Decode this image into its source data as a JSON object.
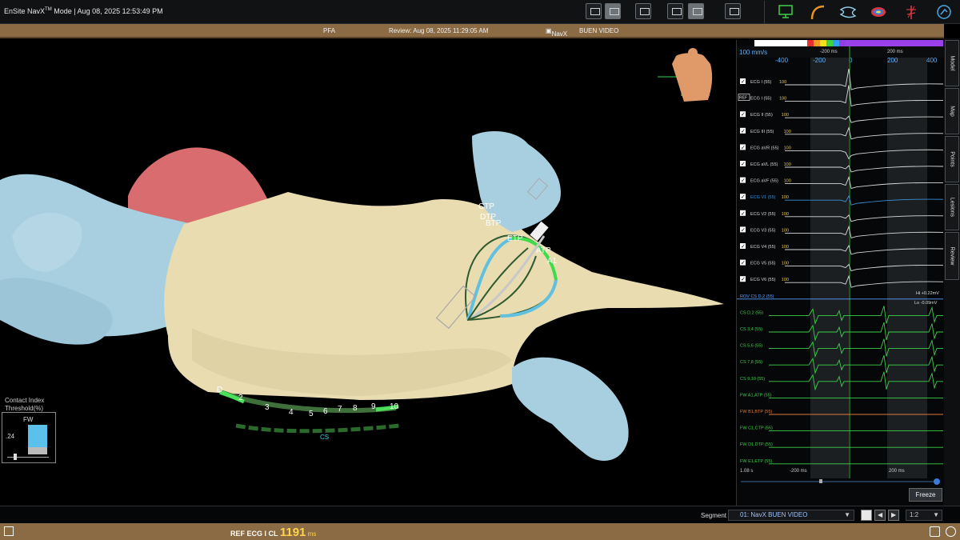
{
  "app": {
    "title_main": "EnSite NavX",
    "title_tm": "TM",
    "title_rest": " Mode |   Aug 08, 2025 12:53:49 PM"
  },
  "toolbar": {
    "icons": [
      "camera-icon",
      "screen-capture-icon",
      "record-icon",
      "split-view-icon",
      "layout-icon",
      "settings-icon"
    ],
    "right_icons": [
      "monitor-icon",
      "catheter-icon",
      "map-icon",
      "model-icon",
      "ablation-icon",
      "help-icon"
    ]
  },
  "review": {
    "mode": "PFA",
    "timestamp": "Review: Aug 08, 2025 11:29:05 AM",
    "system": "NavX",
    "study": "BUEN VIDEO"
  },
  "viewport": {
    "catheter_labels": [
      "CTP",
      "DTP",
      "BTP",
      "ETP",
      "ATP",
      "A1"
    ],
    "cs_electrode_labels": [
      "D",
      "2",
      "3",
      "4",
      "5",
      "6",
      "7",
      "8",
      "9",
      "10"
    ],
    "cs_label": "CS",
    "contact": {
      "title_line1": "Contact Index",
      "title_line2": "Threshold(%)",
      "catheter": "FW",
      "value": ".24",
      "fill_fraction": 0.75,
      "color": "#5bc0ea"
    },
    "colors": {
      "chamber": "#e8dcb0",
      "veins": "#a8cfe0",
      "appendage": "#d96c6f"
    }
  },
  "ecg": {
    "sweep_speed": "100 mm/s",
    "scale_top": [
      "-400",
      "-200",
      "0",
      "200",
      "400"
    ],
    "window_left": "-200 ms",
    "window_right": "200 ms",
    "bottom_time": "1.08 s",
    "bottom_left": "-200 ms",
    "bottom_right": "200 ms",
    "hi_label": "Hi +0.22mV",
    "lo_label": "Lo -0.09mV",
    "channels": [
      {
        "label": "ECG I (55)",
        "gain": "100",
        "color": "#d8d8d8",
        "checkbox": "check"
      },
      {
        "label": "ECG I (55)",
        "gain": "100",
        "color": "#d8d8d8",
        "checkbox": "REF"
      },
      {
        "label": "ECG II (55)",
        "gain": "100",
        "color": "#d8d8d8",
        "checkbox": "check"
      },
      {
        "label": "ECG III (55)",
        "gain": "100",
        "color": "#d8d8d8",
        "checkbox": "check"
      },
      {
        "label": "ECG aVR (55)",
        "gain": "100",
        "color": "#d8d8d8",
        "checkbox": "check"
      },
      {
        "label": "ECG aVL (55)",
        "gain": "100",
        "color": "#d8d8d8",
        "checkbox": "check"
      },
      {
        "label": "ECG aVF (55)",
        "gain": "100",
        "color": "#d8d8d8",
        "checkbox": "check"
      },
      {
        "label": "ECG V1 (55)",
        "gain": "100",
        "color": "#3a8fd6",
        "checkbox": "check"
      },
      {
        "label": "ECG V2 (55)",
        "gain": "100",
        "color": "#d8d8d8",
        "checkbox": "check"
      },
      {
        "label": "ECG V3 (55)",
        "gain": "100",
        "color": "#d8d8d8",
        "checkbox": "check"
      },
      {
        "label": "ECG V4 (55)",
        "gain": "100",
        "color": "#d8d8d8",
        "checkbox": "check"
      },
      {
        "label": "ECG V5 (55)",
        "gain": "100",
        "color": "#d8d8d8",
        "checkbox": "check"
      },
      {
        "label": "ECG V6 (55)",
        "gain": "100",
        "color": "#d8d8d8",
        "checkbox": "check"
      },
      {
        "label": "ROV CS D,2 (55)",
        "gain": "",
        "color": "#5aa0ff",
        "checkbox": ""
      },
      {
        "label": "CS D,2 (55)",
        "gain": "",
        "color": "#3ccf4a",
        "checkbox": ""
      },
      {
        "label": "CS 3,4 (55)",
        "gain": "",
        "color": "#3ccf4a",
        "checkbox": ""
      },
      {
        "label": "CS 5,6 (55)",
        "gain": "",
        "color": "#3ccf4a",
        "checkbox": ""
      },
      {
        "label": "CS 7,8 (55)",
        "gain": "",
        "color": "#3ccf4a",
        "checkbox": ""
      },
      {
        "label": "CS 9,10 (55)",
        "gain": "",
        "color": "#3ccf4a",
        "checkbox": ""
      },
      {
        "label": "FW A1,ATP (55)",
        "gain": "",
        "color": "#3ccf4a",
        "checkbox": ""
      },
      {
        "label": "FW B1,BTP (55)",
        "gain": "",
        "color": "#e07a3a",
        "checkbox": ""
      },
      {
        "label": "FW C1,CTP (55)",
        "gain": "",
        "color": "#3ccf4a",
        "checkbox": ""
      },
      {
        "label": "FW D1,DTP (55)",
        "gain": "",
        "color": "#3ccf4a",
        "checkbox": ""
      },
      {
        "label": "FW E1,ETP (55)",
        "gain": "",
        "color": "#3ccf4a",
        "checkbox": ""
      }
    ],
    "freeze_label": "Freeze"
  },
  "side_tabs": [
    "Model",
    "Map",
    "Points",
    "Lesions",
    "Review"
  ],
  "segment": {
    "label": "Segment",
    "value": "01: NavX BUEN VIDEO",
    "ratio": "1:2"
  },
  "status": {
    "cl_label": "REF ECG I CL ",
    "cl_value": "1191",
    "cl_unit": " ms"
  }
}
